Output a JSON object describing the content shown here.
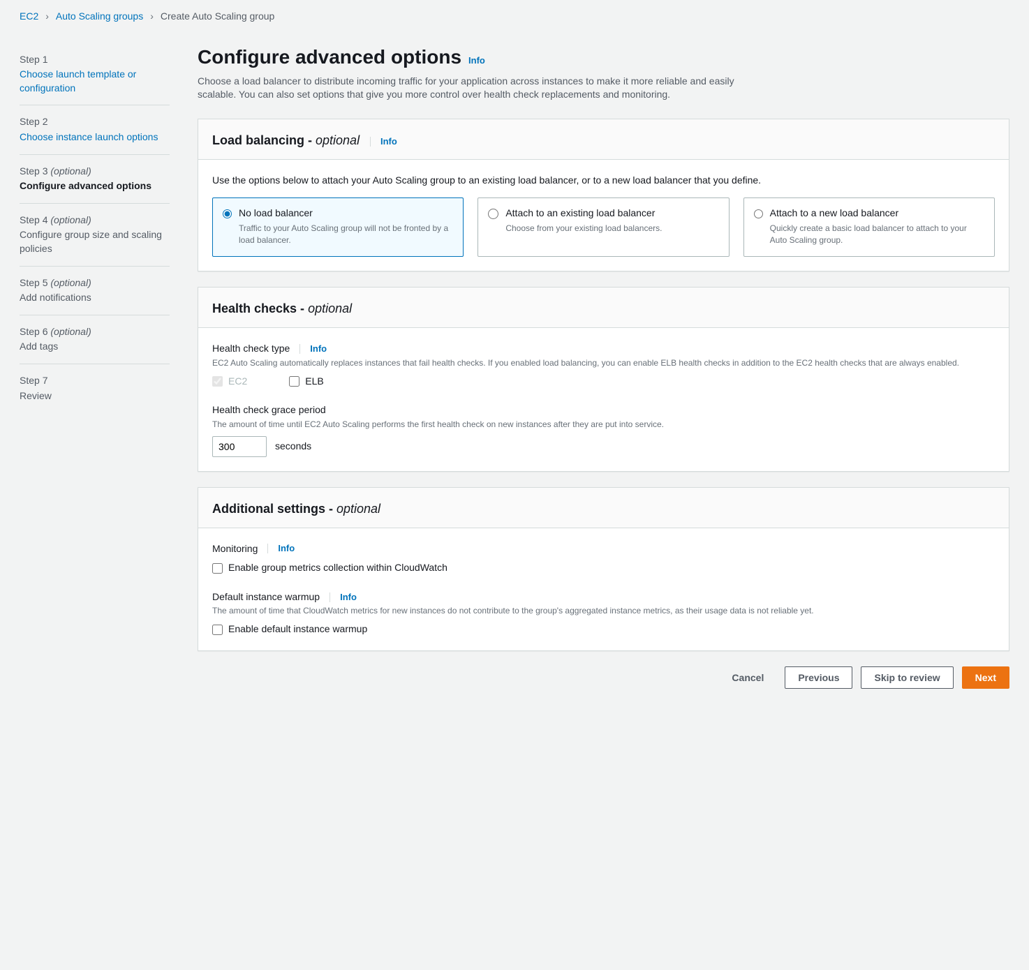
{
  "breadcrumb": {
    "ec2": "EC2",
    "asg": "Auto Scaling groups",
    "current": "Create Auto Scaling group"
  },
  "steps": [
    {
      "label": "Step 1",
      "optional": false,
      "title": "Choose launch template or configuration",
      "state": "link"
    },
    {
      "label": "Step 2",
      "optional": false,
      "title": "Choose instance launch options",
      "state": "link"
    },
    {
      "label": "Step 3",
      "optional": true,
      "title": "Configure advanced options",
      "state": "active"
    },
    {
      "label": "Step 4",
      "optional": true,
      "title": "Configure group size and scaling policies",
      "state": "normal"
    },
    {
      "label": "Step 5",
      "optional": true,
      "title": "Add notifications",
      "state": "normal"
    },
    {
      "label": "Step 6",
      "optional": true,
      "title": "Add tags",
      "state": "normal"
    },
    {
      "label": "Step 7",
      "optional": false,
      "title": "Review",
      "state": "normal"
    }
  ],
  "page": {
    "title": "Configure advanced options",
    "info": "Info",
    "desc": "Choose a load balancer to distribute incoming traffic for your application across instances to make it more reliable and easily scalable. You can also set options that give you more control over health check replacements and monitoring."
  },
  "lb": {
    "heading": "Load balancing - ",
    "optional": "optional",
    "info": "Info",
    "intro": "Use the options below to attach your Auto Scaling group to an existing load balancer, or to a new load balancer that you define.",
    "tiles": [
      {
        "title": "No load balancer",
        "desc": "Traffic to your Auto Scaling group will not be fronted by a load balancer.",
        "selected": true
      },
      {
        "title": "Attach to an existing load balancer",
        "desc": "Choose from your existing load balancers.",
        "selected": false
      },
      {
        "title": "Attach to a new load balancer",
        "desc": "Quickly create a basic load balancer to attach to your Auto Scaling group.",
        "selected": false
      }
    ]
  },
  "health": {
    "heading": "Health checks - ",
    "optional": "optional",
    "type_label": "Health check type",
    "info": "Info",
    "type_desc": "EC2 Auto Scaling automatically replaces instances that fail health checks. If you enabled load balancing, you can enable ELB health checks in addition to the EC2 health checks that are always enabled.",
    "ec2_label": "EC2",
    "elb_label": "ELB",
    "grace_label": "Health check grace period",
    "grace_desc": "The amount of time until EC2 Auto Scaling performs the first health check on new instances after they are put into service.",
    "grace_value": "300",
    "seconds": "seconds"
  },
  "additional": {
    "heading": "Additional settings - ",
    "optional": "optional",
    "monitoring_label": "Monitoring",
    "info": "Info",
    "monitoring_check": "Enable group metrics collection within CloudWatch",
    "warmup_label": "Default instance warmup",
    "warmup_desc": "The amount of time that CloudWatch metrics for new instances do not contribute to the group's aggregated instance metrics, as their usage data is not reliable yet.",
    "warmup_check": "Enable default instance warmup"
  },
  "footer": {
    "cancel": "Cancel",
    "previous": "Previous",
    "skip": "Skip to review",
    "next": "Next"
  },
  "opt_text": "(optional)"
}
